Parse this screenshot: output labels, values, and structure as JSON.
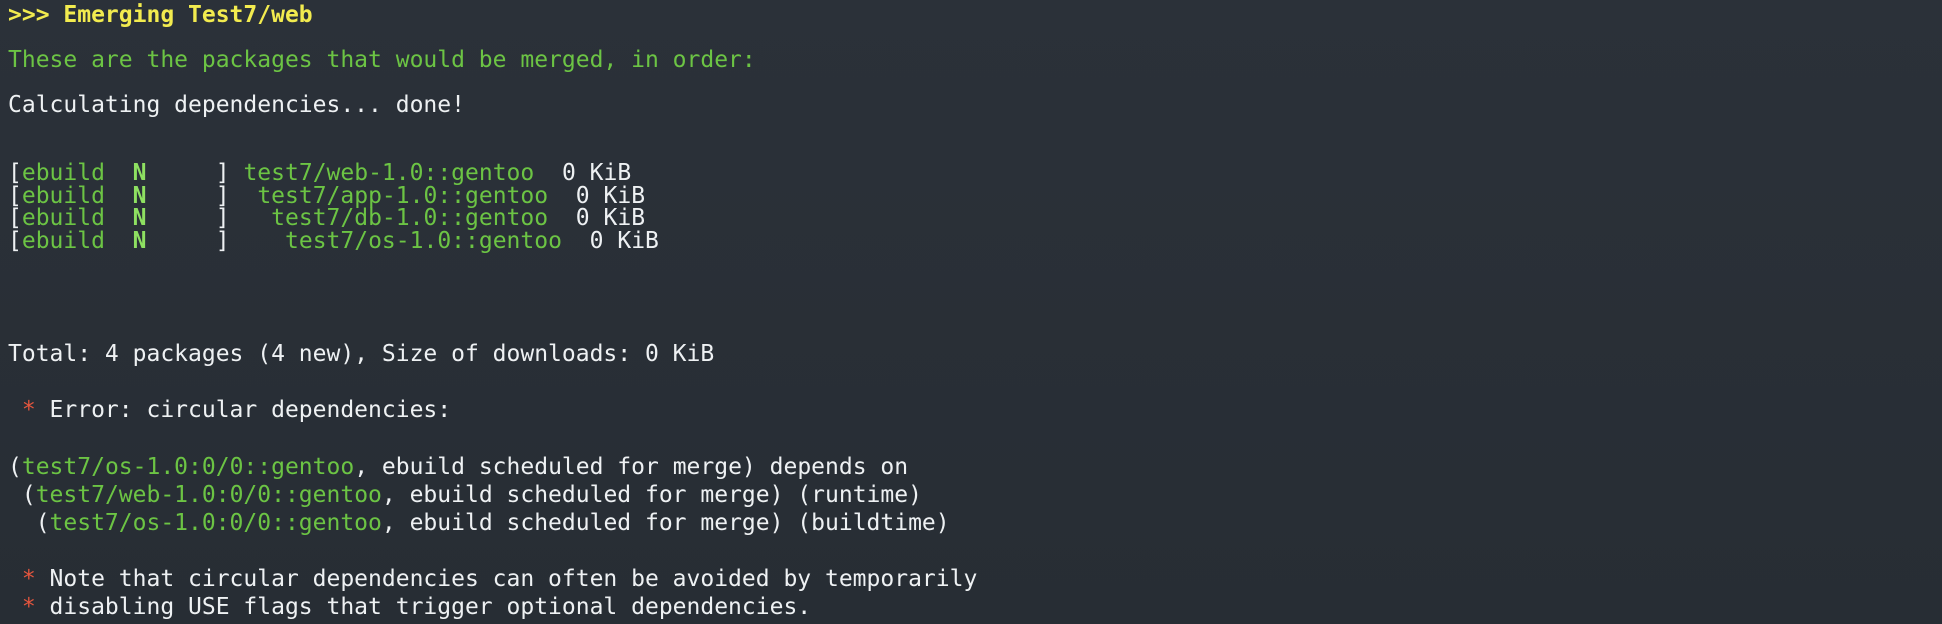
{
  "header": {
    "prompt": ">>> ",
    "title": "Emerging Test7/web"
  },
  "info": {
    "merge_notice": "These are the packages that would be merged, in order:",
    "calculating": "Calculating dependencies... done!"
  },
  "packages": [
    {
      "bracket_open": "[",
      "type": "ebuild",
      "flag": "N",
      "bracket_close": "     ] ",
      "indent": "",
      "atom": "test7/web-1.0::gentoo",
      "size": "  0 KiB"
    },
    {
      "bracket_open": "[",
      "type": "ebuild",
      "flag": "N",
      "bracket_close": "     ] ",
      "indent": " ",
      "atom": "test7/app-1.0::gentoo",
      "size": "  0 KiB"
    },
    {
      "bracket_open": "[",
      "type": "ebuild",
      "flag": "N",
      "bracket_close": "     ] ",
      "indent": "  ",
      "atom": "test7/db-1.0::gentoo",
      "size": "  0 KiB"
    },
    {
      "bracket_open": "[",
      "type": "ebuild",
      "flag": "N",
      "bracket_close": "     ] ",
      "indent": "   ",
      "atom": "test7/os-1.0::gentoo",
      "size": "  0 KiB"
    }
  ],
  "total": "Total: 4 packages (4 new), Size of downloads: 0 KiB",
  "error": {
    "star": " * ",
    "message": "Error: circular dependencies:"
  },
  "cycle": [
    {
      "prefix": "(",
      "atom": "test7/os-1.0:0/0::gentoo",
      "suffix": ", ebuild scheduled for merge) depends on"
    },
    {
      "prefix": " (",
      "atom": "test7/web-1.0:0/0::gentoo",
      "suffix": ", ebuild scheduled for merge) (runtime)"
    },
    {
      "prefix": "  (",
      "atom": "test7/os-1.0:0/0::gentoo",
      "suffix": ", ebuild scheduled for merge) (buildtime)"
    }
  ],
  "notes": [
    {
      "star": " * ",
      "text": "Note that circular dependencies can often be avoided by temporarily"
    },
    {
      "star": " * ",
      "text": "disabling USE flags that trigger optional dependencies."
    }
  ],
  "colors": {
    "background": "#2b3139",
    "yellow": "#f2eb4f",
    "green": "#6cc444",
    "bright_green": "#8ee061",
    "red": "#e6563e",
    "text": "#eef1f3"
  }
}
